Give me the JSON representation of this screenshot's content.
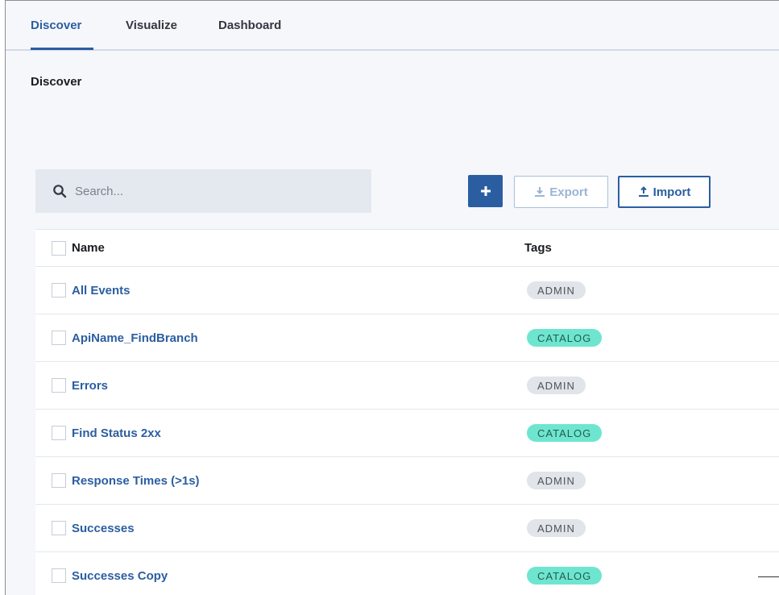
{
  "tabs": [
    {
      "label": "Discover",
      "active": true
    },
    {
      "label": "Visualize",
      "active": false
    },
    {
      "label": "Dashboard",
      "active": false
    }
  ],
  "page_title": "Discover",
  "search": {
    "placeholder": "Search...",
    "value": ""
  },
  "toolbar": {
    "add_label": "+",
    "export_label": "Export",
    "import_label": "Import"
  },
  "table": {
    "headers": {
      "name": "Name",
      "tags": "Tags"
    },
    "rows": [
      {
        "name": "All Events",
        "tag": "ADMIN"
      },
      {
        "name": "ApiName_FindBranch",
        "tag": "CATALOG"
      },
      {
        "name": "Errors",
        "tag": "ADMIN"
      },
      {
        "name": "Find Status 2xx",
        "tag": "CATALOG"
      },
      {
        "name": "Response Times (>1s)",
        "tag": "ADMIN"
      },
      {
        "name": "Successes",
        "tag": "ADMIN"
      },
      {
        "name": "Successes Copy",
        "tag": "CATALOG"
      }
    ]
  },
  "colors": {
    "accent": "#2b5ea1",
    "tag_admin": "#e1e4e8",
    "tag_catalog": "#6ee6cf"
  }
}
